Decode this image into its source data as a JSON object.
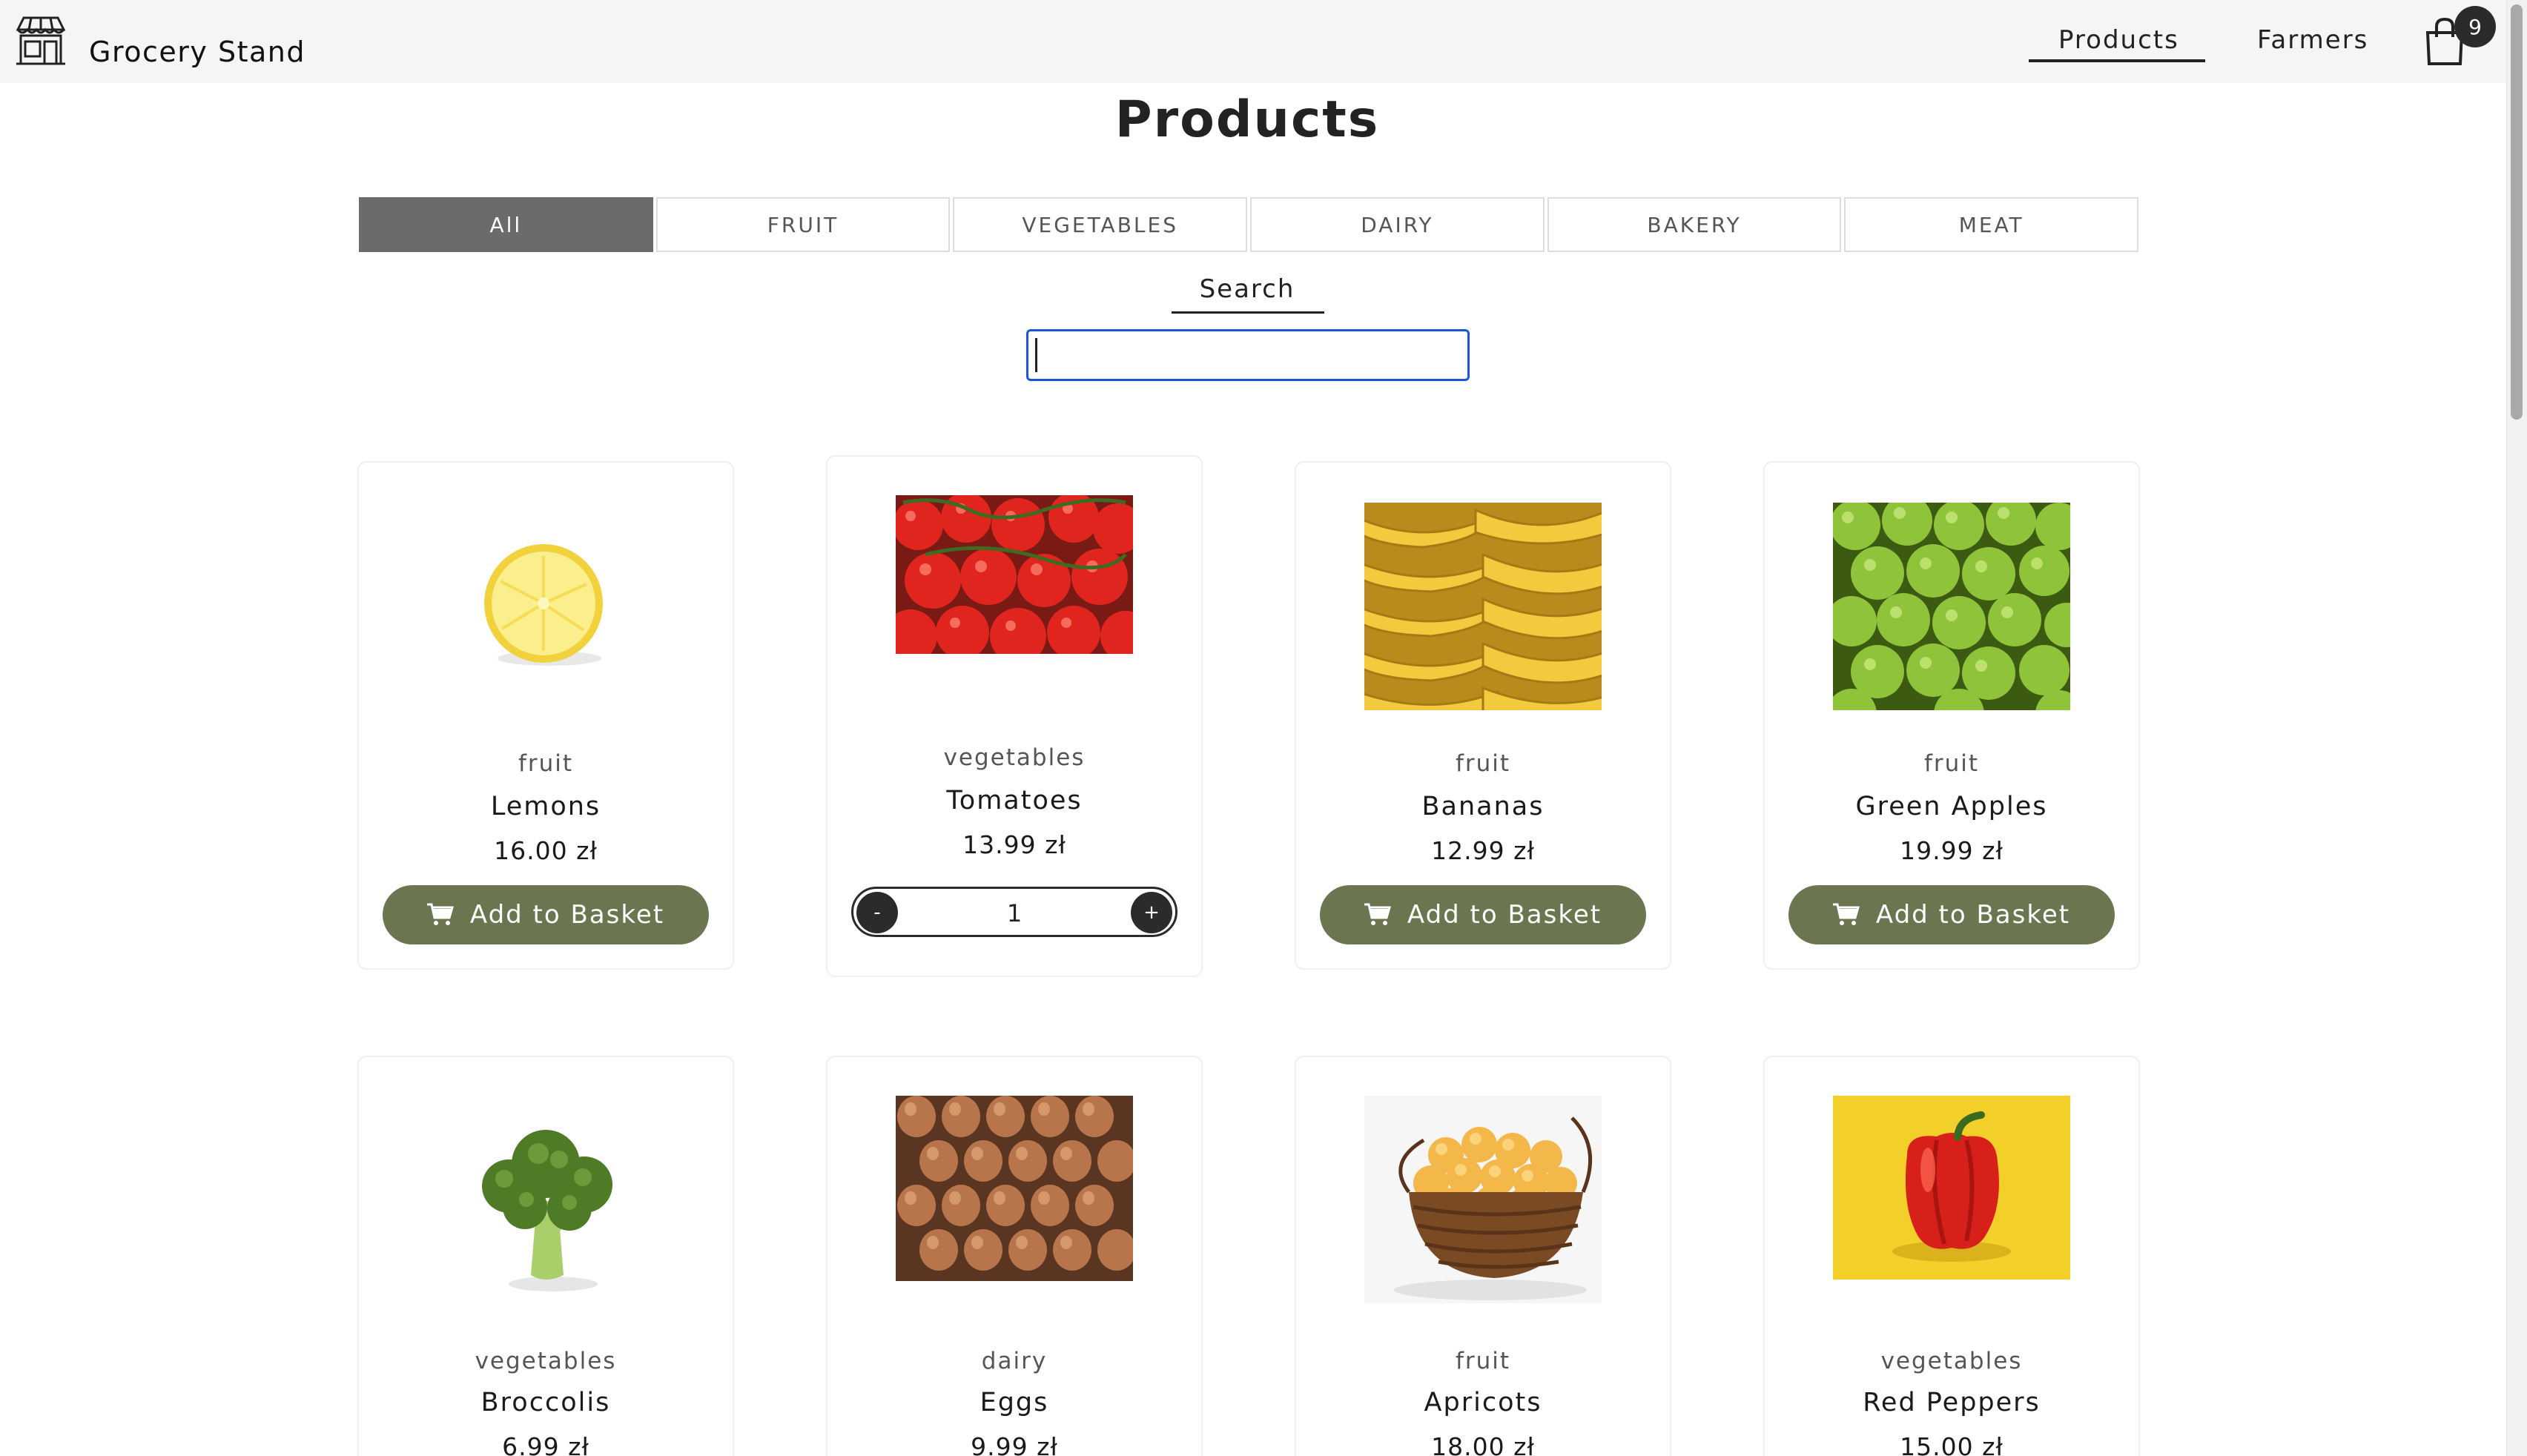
{
  "header": {
    "brand": "Grocery Stand",
    "nav": [
      {
        "label": "Products",
        "active": true
      },
      {
        "label": "Farmers",
        "active": false
      }
    ],
    "cart_count": "9"
  },
  "page_title": "Products",
  "tabs": [
    {
      "label": "All",
      "active": true
    },
    {
      "label": "FRUIT",
      "active": false
    },
    {
      "label": "VEGETABLES",
      "active": false
    },
    {
      "label": "DAIRY",
      "active": false
    },
    {
      "label": "BAKERY",
      "active": false
    },
    {
      "label": "MEAT",
      "active": false
    }
  ],
  "search": {
    "label": "Search",
    "value": ""
  },
  "add_to_basket_label": "Add to Basket",
  "products": [
    {
      "category": "fruit",
      "name": "Lemons",
      "price": "16.00 zł",
      "image": "lemon-image"
    },
    {
      "category": "vegetables",
      "name": "Tomatoes",
      "price": "13.99 zł",
      "image": "tomatoes-image",
      "quantity": "1",
      "minus": "-",
      "plus": "+"
    },
    {
      "category": "fruit",
      "name": "Bananas",
      "price": "12.99 zł",
      "image": "bananas-image"
    },
    {
      "category": "fruit",
      "name": "Green Apples",
      "price": "19.99 zł",
      "image": "green-apples-image"
    },
    {
      "category": "vegetables",
      "name": "Broccolis",
      "price": "6.99 zł",
      "image": "broccoli-image"
    },
    {
      "category": "dairy",
      "name": "Eggs",
      "price": "9.99 zł",
      "image": "eggs-image"
    },
    {
      "category": "fruit",
      "name": "Apricots",
      "price": "18.00 zł",
      "image": "apricots-image"
    },
    {
      "category": "vegetables",
      "name": "Red Peppers",
      "price": "15.00 zł",
      "image": "red-pepper-image"
    }
  ],
  "colors": {
    "button": "#6b7650",
    "active_tab": "#6b6b6b",
    "search_focus": "#1a57d6",
    "badge": "#2b2b2b"
  }
}
